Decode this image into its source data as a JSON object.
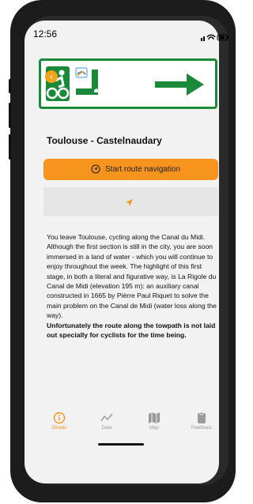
{
  "status_bar": {
    "time": "12:56"
  },
  "route": {
    "title": "Toulouse - Castelnaudary"
  },
  "buttons": {
    "start_navigation": "Start route navigation"
  },
  "description": {
    "body": "You leave Toulouse, cycling along the Canal du Midi. Although the first section is still in the city, you are soon immersed in a land of water - which you will continue to enjoy throughout the week. The highlight of this first stage, in both a literal and figurative way, is La Rigole du Canal de Midi (elevation 195 m): an auxiliary canal constructed in 1665 by Pièrre Paul Riquet to solve the main problem on the Canal de Midi (water loss along the way).",
    "note": "Unfortunately the route along the towpath is not laid out specially for cyclists for the time being."
  },
  "tabs": [
    {
      "label": "Details",
      "icon": "info-icon",
      "active": true
    },
    {
      "label": "Data",
      "icon": "chart-line-icon",
      "active": false
    },
    {
      "label": "Map",
      "icon": "map-icon",
      "active": false
    },
    {
      "label": "Feedback",
      "icon": "clipboard-icon",
      "active": false
    }
  ],
  "colors": {
    "accent": "#f7941d",
    "sign_green": "#1a8a3a",
    "background": "#f2f2f2"
  }
}
